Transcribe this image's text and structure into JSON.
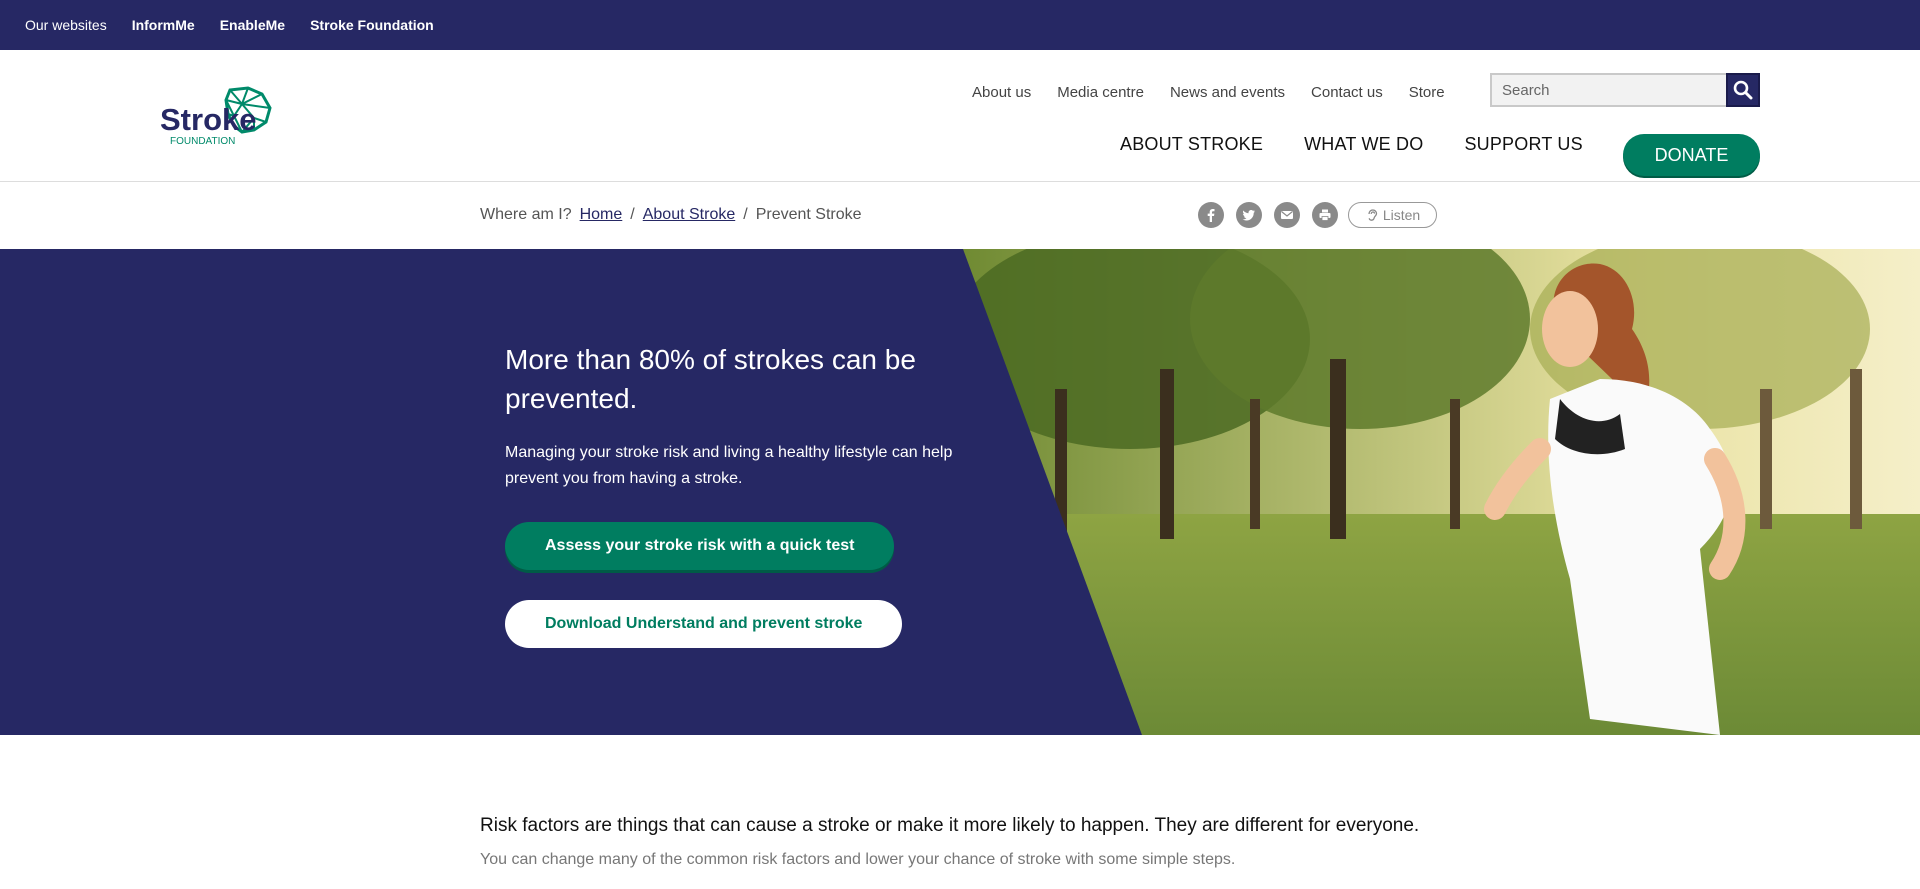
{
  "topbar": {
    "label": "Our websites",
    "links": [
      "InformMe",
      "EnableMe",
      "Stroke Foundation"
    ]
  },
  "header": {
    "logo_text": "Stroke",
    "logo_subtext": "FOUNDATION",
    "utility_nav": [
      "About us",
      "Media centre",
      "News and events",
      "Contact us",
      "Store"
    ],
    "search_placeholder": "Search",
    "main_nav": [
      "ABOUT STROKE",
      "WHAT WE DO",
      "SUPPORT US"
    ],
    "donate_label": "DONATE"
  },
  "breadcrumb": {
    "prefix": "Where am I?",
    "items": [
      "Home",
      "About Stroke"
    ],
    "current": "Prevent Stroke",
    "separator": "/"
  },
  "share": {
    "icons": [
      "facebook-icon",
      "twitter-icon",
      "email-icon",
      "print-icon"
    ],
    "listen_label": "Listen"
  },
  "hero": {
    "title": "More than 80% of strokes can be prevented.",
    "text": "Managing your stroke risk and living a healthy lifestyle can help prevent you from having a stroke.",
    "primary_button": "Assess your stroke risk with a quick test",
    "secondary_button": "Download Understand and prevent stroke"
  },
  "intro": {
    "lead": "Risk factors are things that can cause a stroke or make it more likely to happen. They are different for everyone.",
    "sub": "You can change many of the common risk factors and lower your chance of stroke with some simple steps."
  },
  "colors": {
    "brand_navy": "#262864",
    "brand_green": "#007d60"
  }
}
